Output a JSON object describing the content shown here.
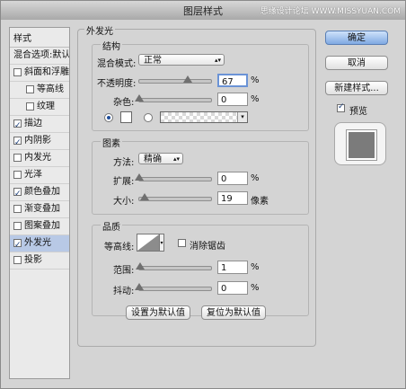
{
  "window": {
    "title": "图层样式",
    "watermark": "思缘设计论坛 WWW.MISSYUAN.COM"
  },
  "sidebar": {
    "header": "样式",
    "blend_options": "混合选项:默认",
    "items": [
      {
        "label": "斜面和浮雕",
        "checked": false,
        "sub": false,
        "selected": false
      },
      {
        "label": "等高线",
        "checked": false,
        "sub": true,
        "selected": false
      },
      {
        "label": "纹理",
        "checked": false,
        "sub": true,
        "selected": false
      },
      {
        "label": "描边",
        "checked": true,
        "sub": false,
        "selected": false
      },
      {
        "label": "内阴影",
        "checked": true,
        "sub": false,
        "selected": false
      },
      {
        "label": "内发光",
        "checked": false,
        "sub": false,
        "selected": false
      },
      {
        "label": "光泽",
        "checked": false,
        "sub": false,
        "selected": false
      },
      {
        "label": "颜色叠加",
        "checked": true,
        "sub": false,
        "selected": false
      },
      {
        "label": "渐变叠加",
        "checked": false,
        "sub": false,
        "selected": false
      },
      {
        "label": "图案叠加",
        "checked": false,
        "sub": false,
        "selected": false
      },
      {
        "label": "外发光",
        "checked": true,
        "sub": false,
        "selected": true
      },
      {
        "label": "投影",
        "checked": false,
        "sub": false,
        "selected": false
      }
    ]
  },
  "outer_glow": {
    "title": "外发光",
    "structure": {
      "title": "结构",
      "blend_mode_label": "混合模式:",
      "blend_mode_value": "正常",
      "opacity_label": "不透明度:",
      "opacity_value": "67",
      "opacity_fraction": 0.67,
      "noise_label": "杂色:",
      "noise_value": "0",
      "noise_fraction": 0.0,
      "percent": "%"
    },
    "elements": {
      "title": "图素",
      "method_label": "方法:",
      "method_value": "精确",
      "spread_label": "扩展:",
      "spread_value": "0",
      "spread_fraction": 0.0,
      "size_label": "大小:",
      "size_value": "19",
      "size_fraction": 0.08,
      "percent": "%",
      "pixels": "像素"
    },
    "quality": {
      "title": "品质",
      "contour_label": "等高线:",
      "antialias_label": "消除锯齿",
      "antialias_checked": false,
      "range_label": "范围:",
      "range_value": "1",
      "range_fraction": 0.01,
      "jitter_label": "抖动:",
      "jitter_value": "0",
      "jitter_fraction": 0.0,
      "percent": "%"
    },
    "buttons": {
      "set_default": "设置为默认值",
      "reset_default": "复位为默认值"
    }
  },
  "actions": {
    "ok": "确定",
    "cancel": "取消",
    "new_style": "新建样式...",
    "preview_label": "预览",
    "preview_checked": true
  },
  "colors": {
    "accent": "#7fa9e2",
    "selected_row": "#b8c9e6"
  }
}
